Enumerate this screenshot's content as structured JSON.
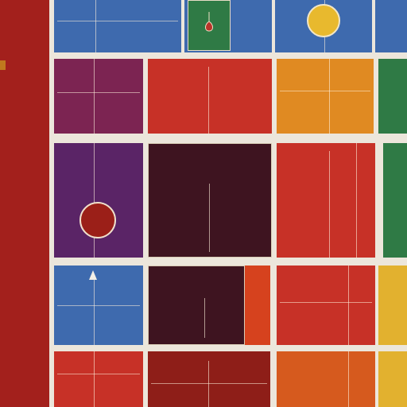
{
  "colors": {
    "crimson": "#a3201c",
    "blue": "#3e6aae",
    "green": "#2f7a45",
    "magenta": "#7c2452",
    "red": "#c73127",
    "orange": "#e08a22",
    "purple": "#5a2466",
    "maroon": "#3e1420",
    "yellow": "#e2b12f",
    "cream": "#ece6db"
  },
  "labels": {
    "row1_blue": "",
    "row1_right": "",
    "row2_magenta": "",
    "row2_red": "",
    "row2_orange": "",
    "row3_purple": "",
    "row3_maroon_title": "",
    "row3_maroon_sub": "",
    "row3_maroon_foot": "",
    "row4_blue": "",
    "row4_maroon_title": "",
    "row4_maroon_sub": "",
    "row4_maroon_foot": "",
    "row4_red": "",
    "row5_red_a": "",
    "row5_red_b": "",
    "row5_maroon": ""
  },
  "icons": [
    "sun-disc-icon",
    "red-disc-icon",
    "up-arrow-icon",
    "seal-icon"
  ]
}
